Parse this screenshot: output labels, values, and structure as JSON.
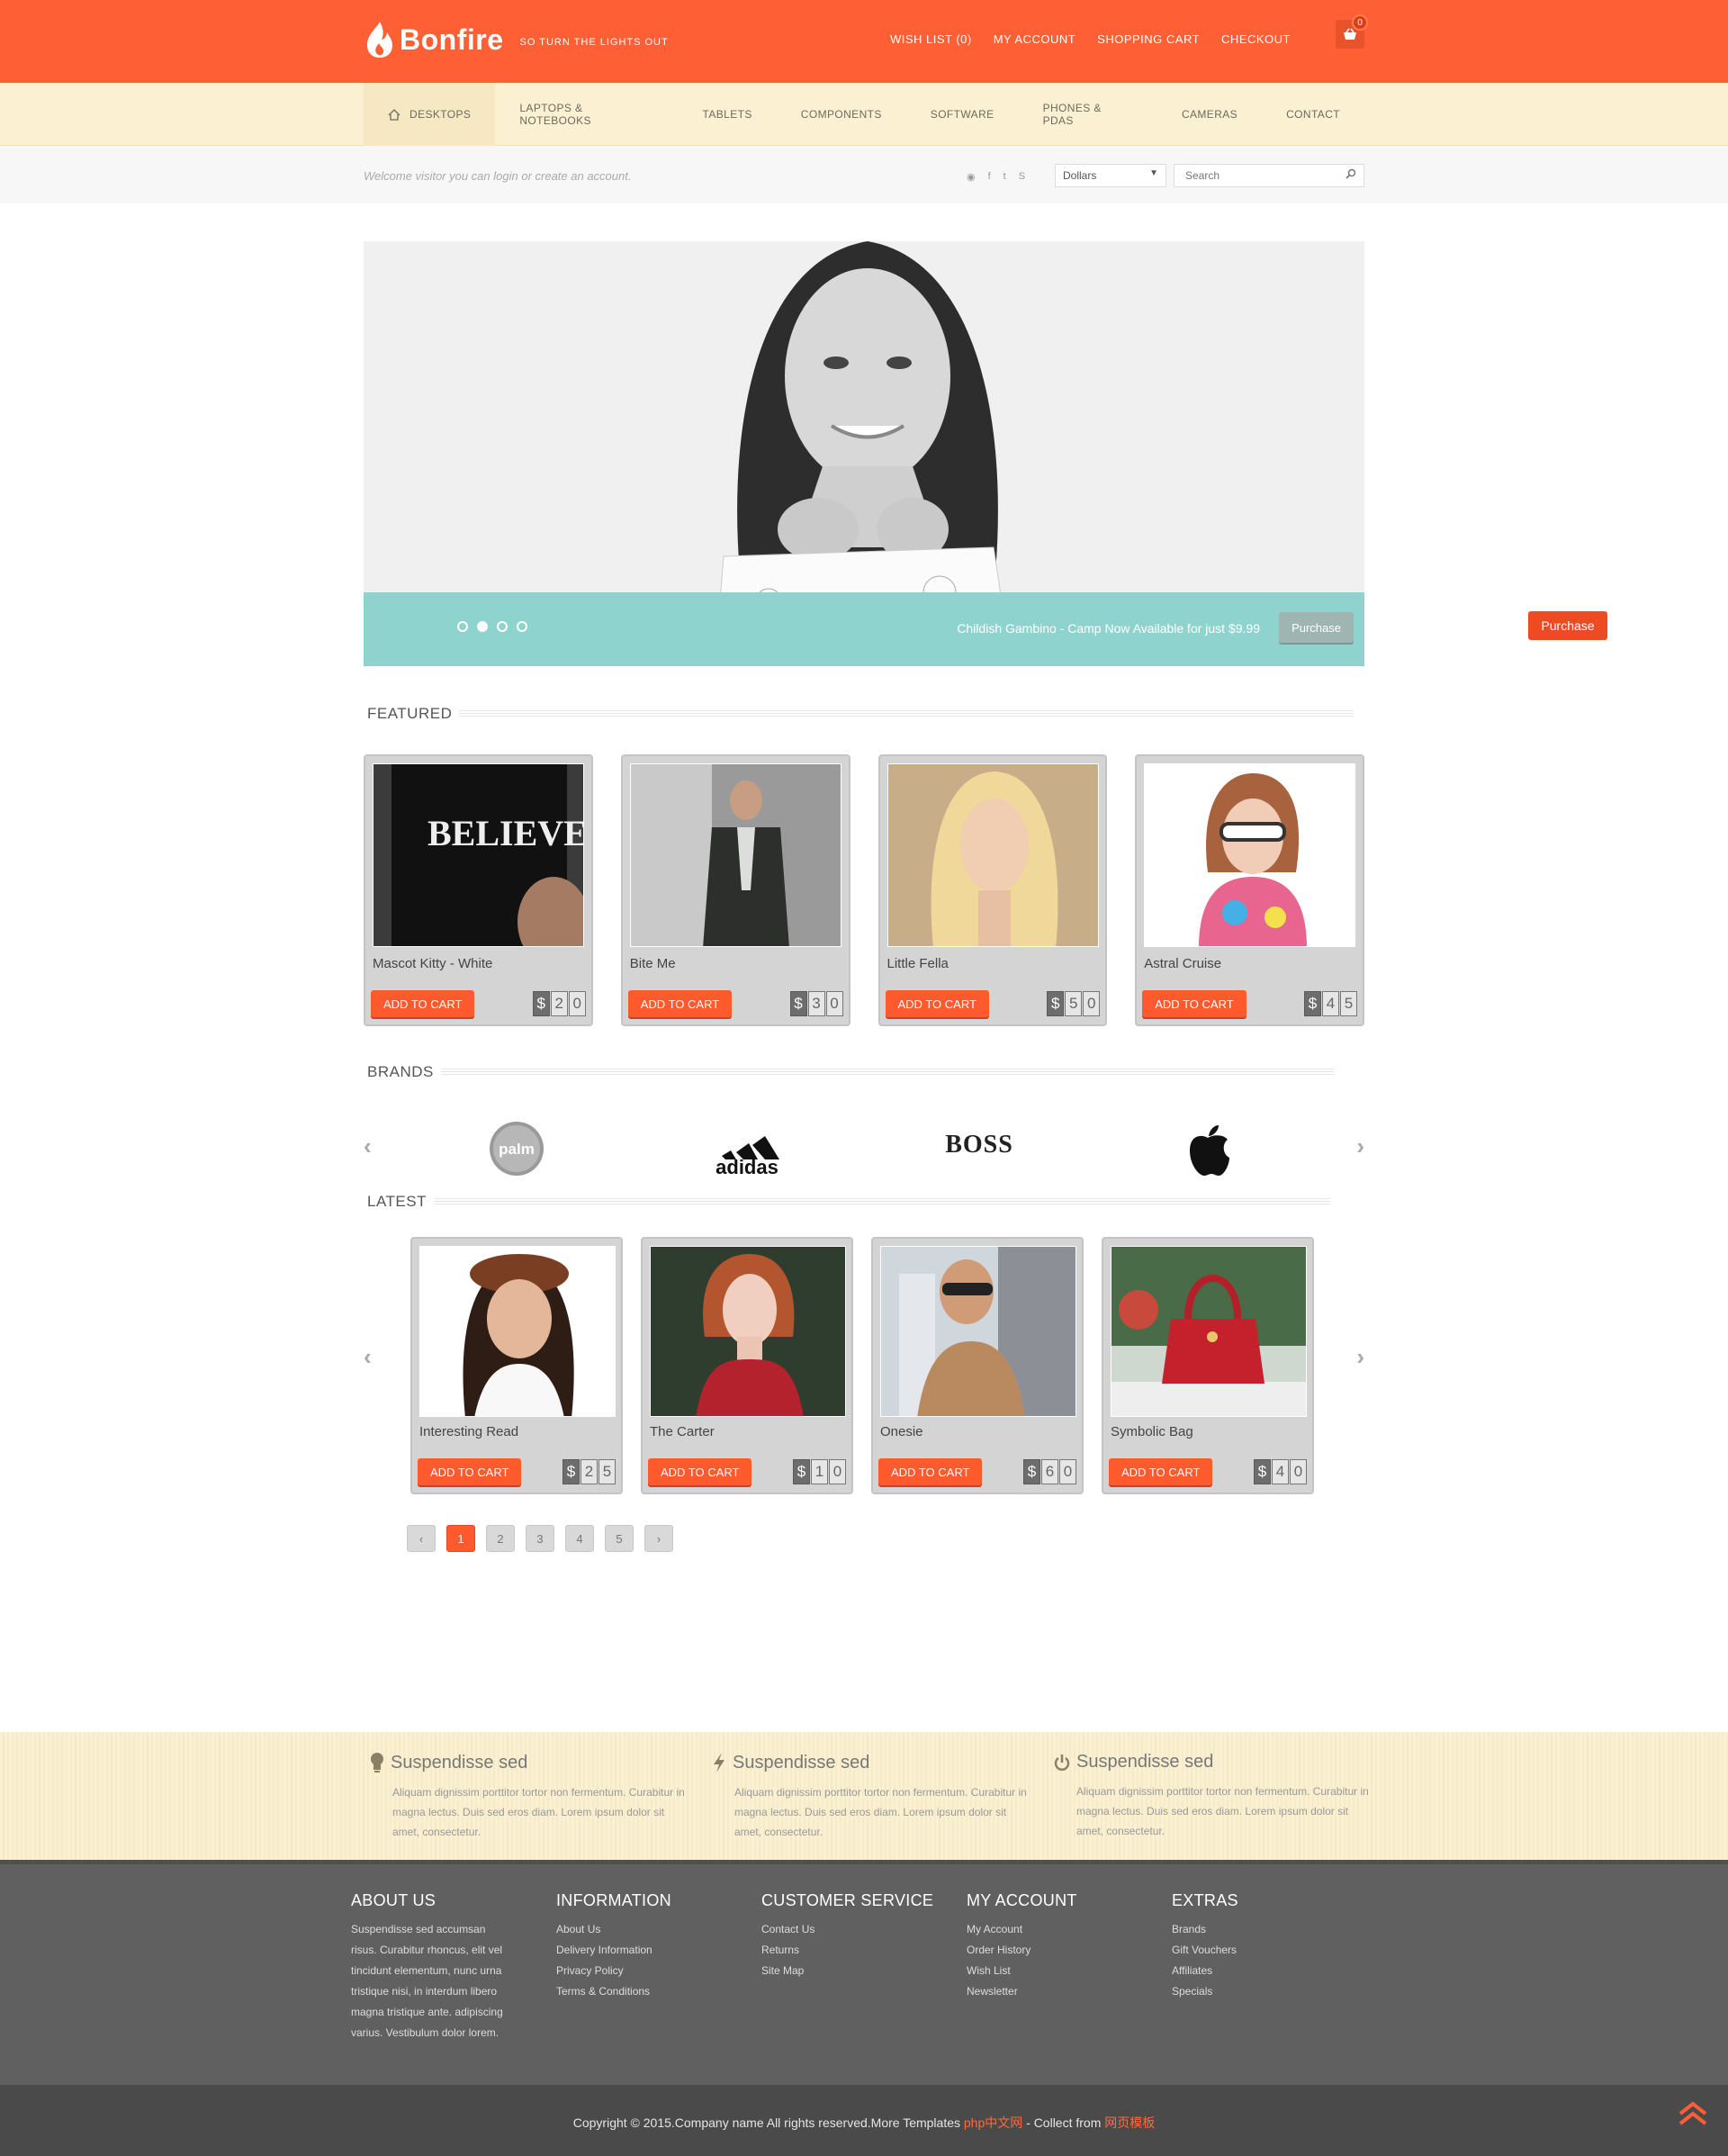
{
  "header": {
    "brand": "Bonfire",
    "tagline": "SO TURN THE LIGHTS OUT",
    "links": [
      "WISH LIST (0)",
      "MY ACCOUNT",
      "SHOPPING CART",
      "CHECKOUT"
    ],
    "cart_count": "0",
    "accent": "#ff5f34"
  },
  "nav": {
    "items": [
      "DESKTOPS",
      "LAPTOPS & NOTEBOOKS",
      "TABLETS",
      "COMPONENTS",
      "SOFTWARE",
      "PHONES & PDAS",
      "CAMERAS",
      "CONTACT"
    ],
    "active": "DESKTOPS"
  },
  "welcome": {
    "text": "Welcome visitor you can login or create an account.",
    "social_icons": [
      "rss-icon",
      "facebook-icon",
      "twitter-icon",
      "skype-icon"
    ],
    "currency": "Dollars",
    "search_placeholder": "Search"
  },
  "slider": {
    "caption": "Childish Gambino - Camp Now Available for just $9.99",
    "button": "Purchase",
    "side_button": "Purchase",
    "dots": 4,
    "active_dot": 2
  },
  "featured": {
    "title": "FEATURED",
    "products": [
      {
        "name": "Mascot Kitty - White",
        "button": "ADD TO CART",
        "price": [
          "$",
          "2",
          "0"
        ]
      },
      {
        "name": "Bite Me",
        "button": "ADD TO CART",
        "price": [
          "$",
          "3",
          "0"
        ]
      },
      {
        "name": "Little Fella",
        "button": "ADD TO CART",
        "price": [
          "$",
          "5",
          "0"
        ]
      },
      {
        "name": "Astral Cruise",
        "button": "ADD TO CART",
        "price": [
          "$",
          "4",
          "5"
        ]
      }
    ]
  },
  "brands": {
    "title": "BRANDS",
    "logos": [
      "palm",
      "adidas",
      "BOSS",
      "apple-logo"
    ]
  },
  "latest": {
    "title": "LATEST",
    "products": [
      {
        "name": "Interesting Read",
        "button": "ADD TO CART",
        "price": [
          "$",
          "2",
          "5"
        ]
      },
      {
        "name": "The Carter",
        "button": "ADD TO CART",
        "price": [
          "$",
          "1",
          "0"
        ]
      },
      {
        "name": "Onesie",
        "button": "ADD TO CART",
        "price": [
          "$",
          "6",
          "0"
        ]
      },
      {
        "name": "Symbolic Bag",
        "button": "ADD TO CART",
        "price": [
          "$",
          "4",
          "0"
        ]
      }
    ]
  },
  "pagination": {
    "prev": "‹",
    "pages": [
      "1",
      "2",
      "3",
      "4",
      "5"
    ],
    "current": "1",
    "next": "›"
  },
  "features": [
    {
      "icon": "lightbulb-icon",
      "title": "Suspendisse sed",
      "text": "Aliquam dignissim porttitor tortor non fermentum. Curabitur in magna lectus. Duis sed eros diam. Lorem ipsum dolor sit amet, consectetur."
    },
    {
      "icon": "bolt-icon",
      "title": "Suspendisse sed",
      "text": "Aliquam dignissim porttitor tortor non fermentum. Curabitur in magna lectus. Duis sed eros diam. Lorem ipsum dolor sit amet, consectetur."
    },
    {
      "icon": "power-icon",
      "title": "Suspendisse sed",
      "text": "Aliquam dignissim porttitor tortor non fermentum. Curabitur in magna lectus. Duis sed eros diam. Lorem ipsum dolor sit amet, consectetur."
    }
  ],
  "footer": {
    "about_title": "ABOUT US",
    "about_text": "Suspendisse sed accumsan risus. Curabitur rhoncus, elit vel tincidunt elementum, nunc urna tristique nisi, in interdum libero magna tristique ante. adipiscing varius. Vestibulum dolor lorem.",
    "columns": [
      {
        "title": "INFORMATION",
        "links": [
          "About Us",
          "Delivery Information",
          "Privacy Policy",
          "Terms & Conditions"
        ]
      },
      {
        "title": "CUSTOMER SERVICE",
        "links": [
          "Contact Us",
          "Returns",
          "Site Map"
        ]
      },
      {
        "title": "MY ACCOUNT",
        "links": [
          "My Account",
          "Order History",
          "Wish List",
          "Newsletter"
        ]
      },
      {
        "title": "EXTRAS",
        "links": [
          "Brands",
          "Gift Vouchers",
          "Affiliates",
          "Specials"
        ]
      }
    ],
    "copyright_prefix": "Copyright © 2015.Company name All rights reserved.More Templates ",
    "copyright_link1": "php中文网",
    "copyright_mid": " - Collect from ",
    "copyright_link2": "网页模板"
  }
}
